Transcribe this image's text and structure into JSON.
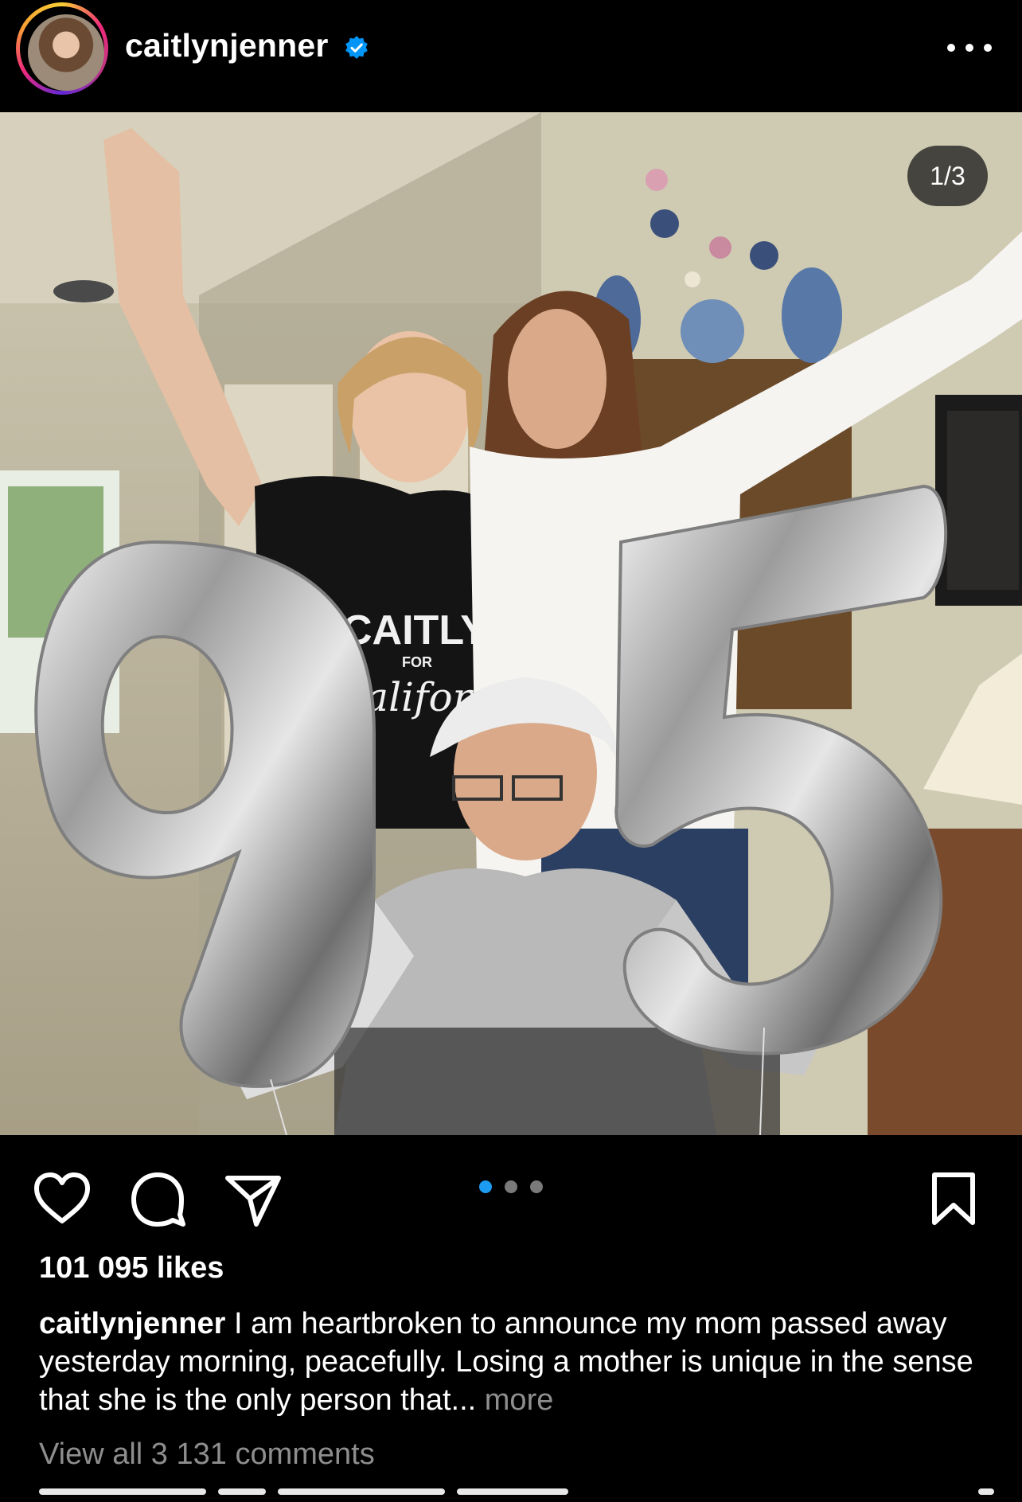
{
  "header": {
    "username": "caitlynjenner",
    "verified": true,
    "avatar_icon": "profile-photo",
    "more_icon": "more-horizontal-icon"
  },
  "media": {
    "page_counter": "1/3",
    "current_index": 1,
    "total": 3,
    "balloon_digits": [
      "9",
      "5"
    ],
    "shirt_text": {
      "line1": "CAITLYN",
      "line2": "FOR",
      "line3": "California"
    }
  },
  "actions": {
    "like_icon": "heart-icon",
    "comment_icon": "comment-icon",
    "share_icon": "paper-plane-icon",
    "save_icon": "bookmark-icon",
    "active_dot_color": "#1d9bf0"
  },
  "post": {
    "likes": "101 095 likes",
    "caption_user": "caitlynjenner",
    "caption_text": "I am heartbroken to announce my mom passed away yesterday morning, peacefully. Losing a mother is unique in the sense that she is the only person that...",
    "caption_more": "more",
    "view_comments": "View all 3 131 comments"
  },
  "colors": {
    "background": "#000000",
    "text": "#ffffff",
    "muted": "#8e8e8e",
    "verified": "#0095f6"
  }
}
